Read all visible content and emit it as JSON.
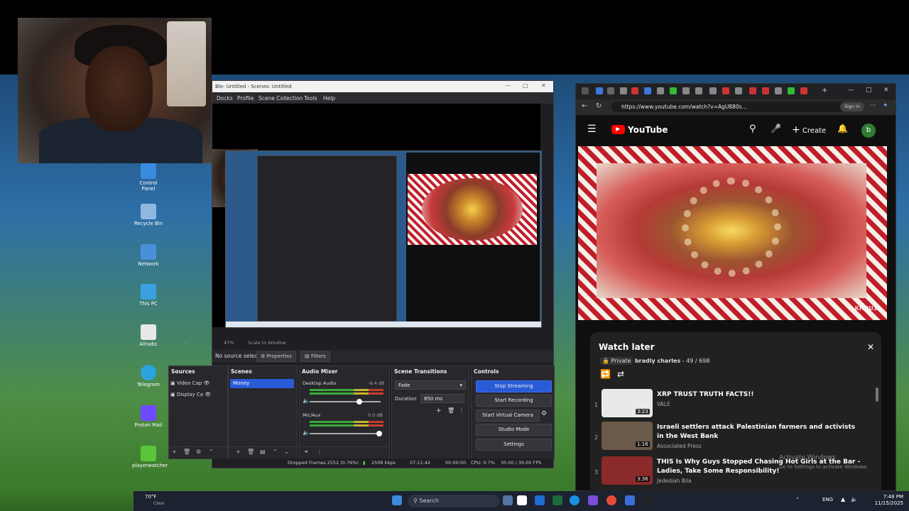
{
  "desktop": {
    "icons": [
      {
        "label": "Control Panel",
        "color": "#3a8be0"
      },
      {
        "label": "Recycle Bin",
        "color": "#8fb8e0"
      },
      {
        "label": "Network",
        "color": "#4a90d9"
      },
      {
        "label": "This PC",
        "color": "#3aa0e0"
      },
      {
        "label": "Allnabc",
        "color": "#e8e8e8"
      },
      {
        "label": "Telegram",
        "color": "#2aa3df"
      },
      {
        "label": "Proton Mail",
        "color": "#6d4aff"
      },
      {
        "label": "playerwatcher",
        "color": "#5bc43b"
      }
    ]
  },
  "obs": {
    "title": "Ble: Untitled - Scenes: Untitled",
    "menu": [
      "Docks",
      "Profile",
      "Scene Collection",
      "Tools",
      "Help"
    ],
    "zoom_text": "47%",
    "scale_text": "Scale to Window",
    "no_source": "No source selected",
    "properties_label": "Properties",
    "filters_label": "Filters",
    "sources": {
      "header": "Sources",
      "items": [
        "Video Cap",
        "Display Ca"
      ]
    },
    "scenes": {
      "header": "Scenes",
      "items": [
        "Money"
      ]
    },
    "mixer": {
      "header": "Audio Mixer",
      "channels": [
        {
          "name": "Desktop Audio",
          "db": "-9.4 dB"
        },
        {
          "name": "Mic/Aux",
          "db": "0.0 dB"
        }
      ]
    },
    "transitions": {
      "header": "Scene Transitions",
      "type": "Fade",
      "duration_label": "Duration",
      "duration": "850 ms"
    },
    "controls": {
      "header": "Controls",
      "stop_streaming": "Stop Streaming",
      "start_recording": "Start Recording",
      "start_virtual_camera": "Start Virtual Camera",
      "studio_mode": "Studio Mode",
      "settings": "Settings"
    },
    "status": {
      "dropped": "Dropped Frames 2552 (0.76%)",
      "bitrate": "2508 kbps",
      "stream_time": "07:11:42",
      "rec_time": "00:00:00",
      "cpu": "CPU: 0.7%",
      "fps": "30.00 / 30.00 FPS"
    }
  },
  "browser": {
    "url": "https://www.youtube.com/watch?v=AgU880s...",
    "sign_in": "Sign in",
    "yt_logo_text": "YouTube",
    "create_label": "Create",
    "avatar_letter": "b",
    "player_watermark": "KHOU11",
    "watch_later": {
      "title": "Watch later",
      "privacy": "Private",
      "owner": "bradly charles",
      "position": "49 / 698",
      "items": [
        {
          "num": "1",
          "title": "XRP TRUST TRUTH FACTS!!",
          "channel": "VALE",
          "duration": "3:23",
          "thumb_color": "#e9e9e9"
        },
        {
          "num": "2",
          "title": "Israeli settlers attack Palestinian farmers and activists in the West Bank",
          "channel": "Associated Press",
          "duration": "1:16",
          "thumb_color": "#6b5a4a"
        },
        {
          "num": "3",
          "title": "THIS Is Why Guys Stopped Chasing Hot Girls at the Bar - Ladies, Take Some Responsibility!",
          "channel": "Jedediah Bila",
          "duration": "3:36",
          "thumb_color": "#8a2a2a"
        }
      ]
    }
  },
  "activate_windows": {
    "line1": "Activate Windows",
    "line2": "Go to Settings to activate Windows."
  },
  "taskbar": {
    "weather_temp": "70°F",
    "weather_desc": "Clear",
    "search_placeholder": "Search",
    "lang": "ENG",
    "time": "7:48 PM",
    "date": "11/15/2025"
  }
}
